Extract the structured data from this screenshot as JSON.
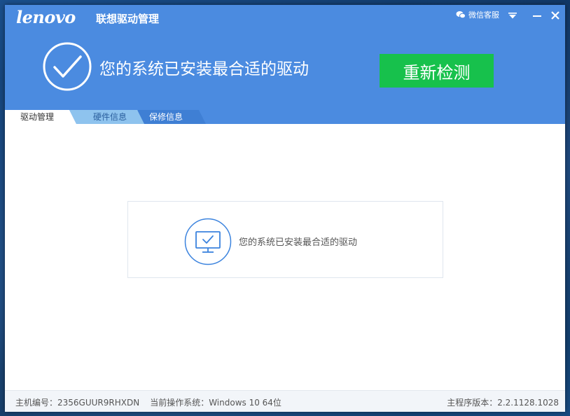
{
  "app": {
    "logo": "lenovo",
    "title": "联想驱动管理"
  },
  "titlebar": {
    "wechat_service": "微信客服",
    "icons": [
      "wechat-icon",
      "dropdown-arrow-icon",
      "minimize-icon",
      "close-icon"
    ]
  },
  "status": {
    "title": "您的系统已安装最合适的驱动",
    "icon": "checkmark-circle-icon"
  },
  "actions": {
    "redetect": "重新检测"
  },
  "tabs": [
    {
      "label": "驱动管理",
      "active": true
    },
    {
      "label": "硬件信息",
      "active": false
    },
    {
      "label": "保修信息",
      "active": false
    }
  ],
  "content": {
    "message": "您的系统已安装最合适的驱动",
    "icon": "monitor-check-icon"
  },
  "footer": {
    "machine_id": "主机编号：2356GUUR9RHXDN",
    "os": "当前操作系统：Windows 10 64位",
    "version": "主程序版本：2.2.1128.1028"
  },
  "colors": {
    "header": "#4b8be0",
    "redetect_button": "#17c14c",
    "tab_active": "#ffffff",
    "tab_inactive_1": "#8ec3ee",
    "tab_inactive_2": "#3f7fd4",
    "accent_icon": "#3b83de"
  }
}
